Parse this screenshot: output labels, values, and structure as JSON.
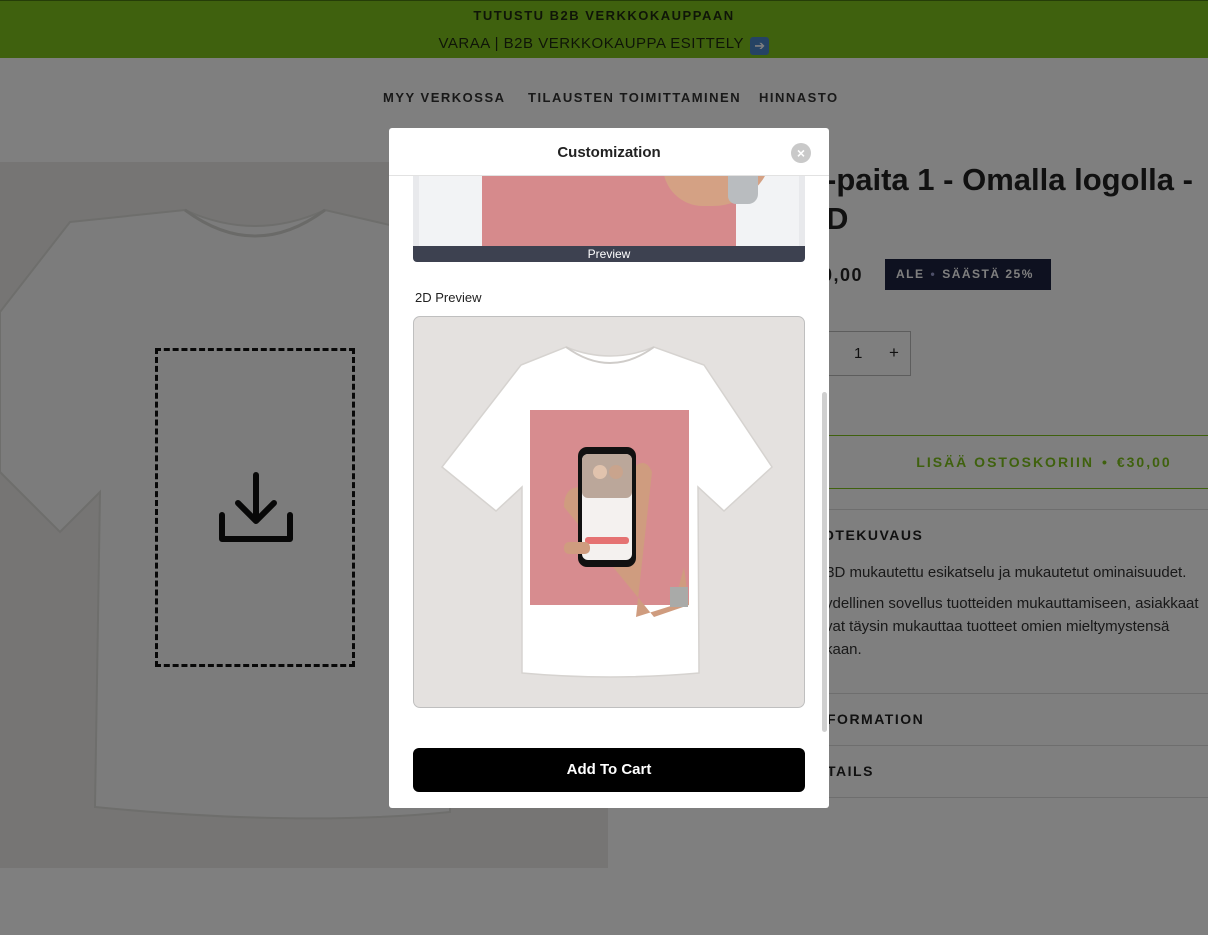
{
  "announcement": {
    "line1": "TUTUSTU B2B VERKKOKAUPPAAN",
    "line2": "VARAA | B2B VERKKOKAUPPA ESITTELY",
    "line2_icon": "arrow-right-icon",
    "color": "#7ec31c"
  },
  "nav": {
    "items": [
      {
        "label": "MYY VERKOSSA"
      },
      {
        "label": "TILAUSTEN TOIMITTAMINEN"
      },
      {
        "label": "HINNASTO"
      }
    ]
  },
  "product": {
    "title": "-paita 1 - Omalla logolla - D",
    "price": "0,00",
    "sale_badge": {
      "part1": "ALE",
      "separator": "•",
      "part2": "SÄÄSTÄ 25%"
    },
    "quantity": {
      "value": "1",
      "plus": "+"
    },
    "add_to_cart": {
      "label": "LISÄÄ OSTOSKORIIN",
      "separator": "•",
      "price": "€30,00"
    },
    "accordion": [
      {
        "title": "OTEKUVAUS"
      },
      {
        "title": "FORMATION"
      },
      {
        "title": "TAILS"
      }
    ],
    "description": {
      "line1": "/3D mukautettu esikatselu ja mukautetut ominaisuudet.",
      "line2": "ydellinen sovellus tuotteiden mukauttamiseen, asiakkaat",
      "line3": "vat täysin mukauttaa tuotteet omien mieltymystensä",
      "line4": "kaan."
    }
  },
  "modal": {
    "title": "Customization",
    "close_icon": "close-icon",
    "preview_bar_label": "Preview",
    "section_2d_label": "2D Preview",
    "add_to_cart_label": "Add To Cart"
  }
}
